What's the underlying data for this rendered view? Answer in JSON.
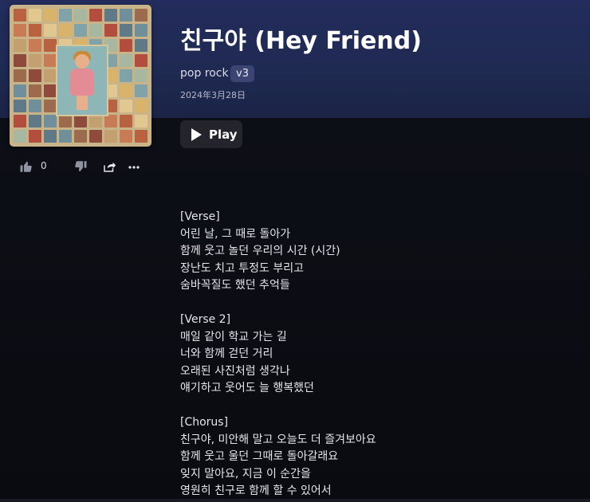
{
  "song": {
    "title": "친구야 (Hey Friend)",
    "genre": "pop rock",
    "version": "v3",
    "date": "2024年3月28日"
  },
  "player": {
    "play_label": "Play"
  },
  "actions": {
    "like_count": "0",
    "like_icon": "thumbs-up-icon",
    "dislike_icon": "thumbs-down-icon",
    "share_icon": "share-icon",
    "more_icon": "more-icon"
  },
  "colors": {
    "banner": "#232c5c",
    "background": "#0b0c11",
    "version_badge": "#3c4572"
  },
  "lyrics": [
    "[Verse]",
    "어린 날, 그 때로 돌아가",
    "함께 웃고 놀던 우리의 시간 (시간)",
    "장난도 치고 투정도 부리고",
    "숨바꼭질도 했던 추억들",
    "",
    "[Verse 2]",
    "매일 같이 학교 가는 길",
    "너와 함께 걷던 거리",
    "오래된 사진처럼 생각나",
    "얘기하고 웃어도 늘 행복했던",
    "",
    "[Chorus]",
    "친구야, 미안해 말고 오늘도 더 즐겨보아요",
    "함께 웃고 울던 그때로 돌아갈래요",
    "잊지 말아요, 지금 이 순간을",
    "영원히 친구로 함께 할 수 있어서"
  ]
}
